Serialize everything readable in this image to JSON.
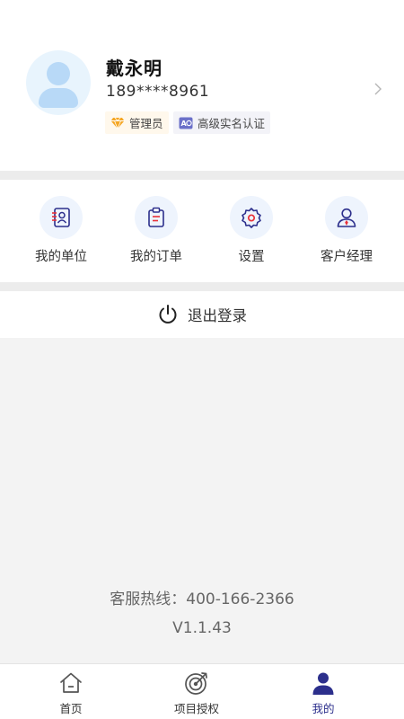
{
  "profile": {
    "name": "戴永明",
    "phone": "189****8961",
    "badges": [
      {
        "label": "管理员",
        "icon": "diamond-icon"
      },
      {
        "label": "高级实名认证",
        "icon": "id-verify-icon"
      }
    ]
  },
  "menu": {
    "items": [
      {
        "label": "我的单位",
        "icon": "unit-contact-icon"
      },
      {
        "label": "我的订单",
        "icon": "order-clipboard-icon"
      },
      {
        "label": "设置",
        "icon": "gear-icon"
      },
      {
        "label": "客户经理",
        "icon": "manager-icon"
      }
    ]
  },
  "logout": {
    "label": "退出登录",
    "icon": "power-icon"
  },
  "footer": {
    "hotline": "客服热线：400-166-2366",
    "version": "V1.1.43"
  },
  "tabbar": {
    "tabs": [
      {
        "label": "首页",
        "icon": "home-icon"
      },
      {
        "label": "项目授权",
        "icon": "target-icon"
      },
      {
        "label": "我的",
        "icon": "person-icon",
        "active": true
      }
    ]
  },
  "colors": {
    "accent": "#2c2f8c",
    "icon_red": "#e8313a",
    "icon_bg": "#eef4fd",
    "badge_gold": "#f5a623",
    "page_bg": "#f3f3f3"
  }
}
